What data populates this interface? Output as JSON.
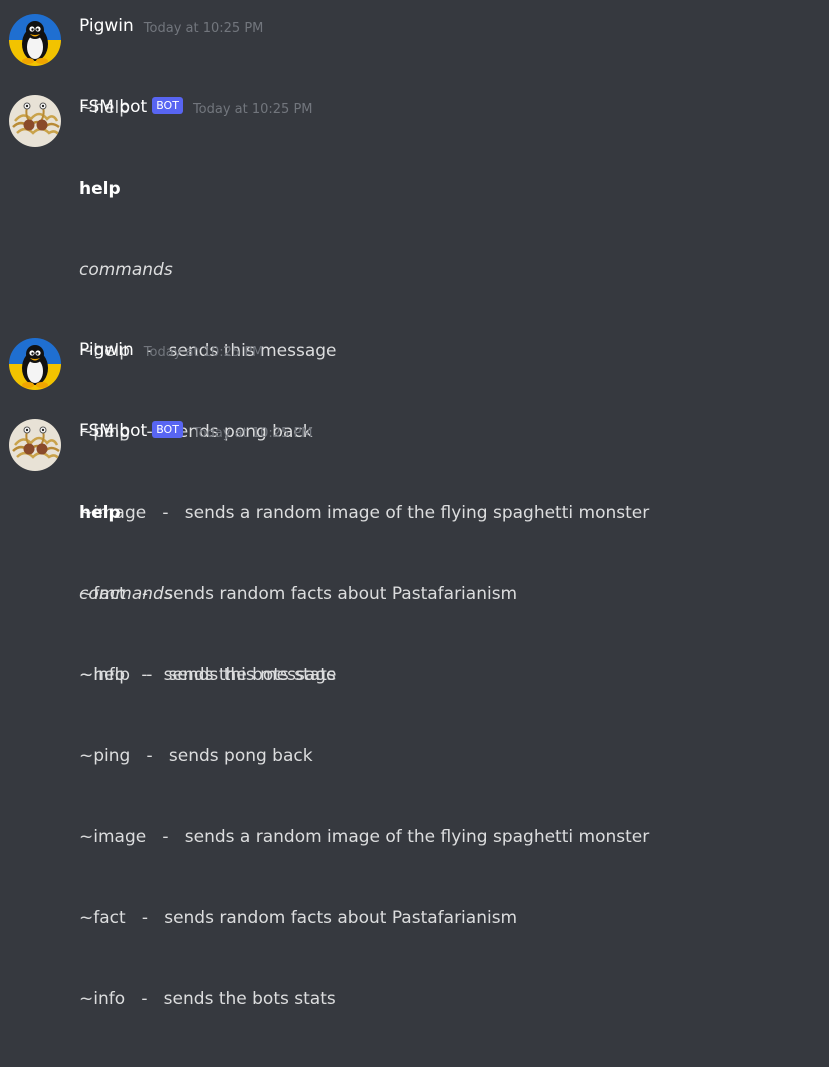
{
  "messages": [
    {
      "author": "Pigwin",
      "timestamp": "Today at 10:25 PM",
      "text": "~help"
    },
    {
      "author": "FSM bot",
      "badge": "BOT",
      "timestamp": "Today at 10:25 PM",
      "embed_title": "help",
      "embed_subtitle": "commands",
      "commands": [
        "~help   -   sends this message",
        "~ping   -   sends pong back",
        "~image   -   sends a random image of the flying spaghetti monster",
        "~fact   -   sends random facts about Pastafarianism",
        "~info   -   sends the bots stats"
      ]
    },
    {
      "author": "Pigwin",
      "timestamp": "Today at 10:25 PM",
      "text": "~help"
    },
    {
      "author": "FSM bot",
      "badge": "BOT",
      "timestamp": "Today at 10:25 PM",
      "embed_title": "help",
      "embed_subtitle": "commands",
      "commands": [
        "~help   -   sends this message",
        "~ping   -   sends pong back",
        "~image   -   sends a random image of the flying spaghetti monster",
        "~fact   -   sends random facts about Pastafarianism",
        "~info   -   sends the bots stats"
      ]
    }
  ],
  "icons": {
    "user_avatar": "penguin-avatar-icon",
    "bot_avatar": "spaghetti-monster-avatar-icon"
  },
  "colors": {
    "background": "#36393f",
    "text": "#dcddde",
    "username": "#ffffff",
    "timestamp": "#72767d",
    "bot_badge": "#5865f2"
  }
}
